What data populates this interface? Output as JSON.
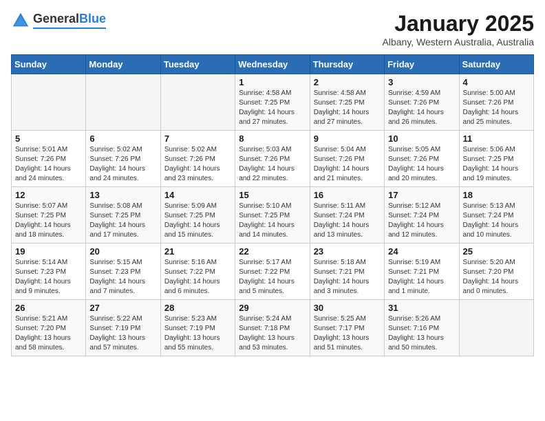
{
  "header": {
    "logo_general": "General",
    "logo_blue": "Blue",
    "month_title": "January 2025",
    "location": "Albany, Western Australia, Australia"
  },
  "weekdays": [
    "Sunday",
    "Monday",
    "Tuesday",
    "Wednesday",
    "Thursday",
    "Friday",
    "Saturday"
  ],
  "weeks": [
    [
      {
        "day": "",
        "info": ""
      },
      {
        "day": "",
        "info": ""
      },
      {
        "day": "",
        "info": ""
      },
      {
        "day": "1",
        "info": "Sunrise: 4:58 AM\nSunset: 7:25 PM\nDaylight: 14 hours\nand 27 minutes."
      },
      {
        "day": "2",
        "info": "Sunrise: 4:58 AM\nSunset: 7:25 PM\nDaylight: 14 hours\nand 27 minutes."
      },
      {
        "day": "3",
        "info": "Sunrise: 4:59 AM\nSunset: 7:26 PM\nDaylight: 14 hours\nand 26 minutes."
      },
      {
        "day": "4",
        "info": "Sunrise: 5:00 AM\nSunset: 7:26 PM\nDaylight: 14 hours\nand 25 minutes."
      }
    ],
    [
      {
        "day": "5",
        "info": "Sunrise: 5:01 AM\nSunset: 7:26 PM\nDaylight: 14 hours\nand 24 minutes."
      },
      {
        "day": "6",
        "info": "Sunrise: 5:02 AM\nSunset: 7:26 PM\nDaylight: 14 hours\nand 24 minutes."
      },
      {
        "day": "7",
        "info": "Sunrise: 5:02 AM\nSunset: 7:26 PM\nDaylight: 14 hours\nand 23 minutes."
      },
      {
        "day": "8",
        "info": "Sunrise: 5:03 AM\nSunset: 7:26 PM\nDaylight: 14 hours\nand 22 minutes."
      },
      {
        "day": "9",
        "info": "Sunrise: 5:04 AM\nSunset: 7:26 PM\nDaylight: 14 hours\nand 21 minutes."
      },
      {
        "day": "10",
        "info": "Sunrise: 5:05 AM\nSunset: 7:26 PM\nDaylight: 14 hours\nand 20 minutes."
      },
      {
        "day": "11",
        "info": "Sunrise: 5:06 AM\nSunset: 7:25 PM\nDaylight: 14 hours\nand 19 minutes."
      }
    ],
    [
      {
        "day": "12",
        "info": "Sunrise: 5:07 AM\nSunset: 7:25 PM\nDaylight: 14 hours\nand 18 minutes."
      },
      {
        "day": "13",
        "info": "Sunrise: 5:08 AM\nSunset: 7:25 PM\nDaylight: 14 hours\nand 17 minutes."
      },
      {
        "day": "14",
        "info": "Sunrise: 5:09 AM\nSunset: 7:25 PM\nDaylight: 14 hours\nand 15 minutes."
      },
      {
        "day": "15",
        "info": "Sunrise: 5:10 AM\nSunset: 7:25 PM\nDaylight: 14 hours\nand 14 minutes."
      },
      {
        "day": "16",
        "info": "Sunrise: 5:11 AM\nSunset: 7:24 PM\nDaylight: 14 hours\nand 13 minutes."
      },
      {
        "day": "17",
        "info": "Sunrise: 5:12 AM\nSunset: 7:24 PM\nDaylight: 14 hours\nand 12 minutes."
      },
      {
        "day": "18",
        "info": "Sunrise: 5:13 AM\nSunset: 7:24 PM\nDaylight: 14 hours\nand 10 minutes."
      }
    ],
    [
      {
        "day": "19",
        "info": "Sunrise: 5:14 AM\nSunset: 7:23 PM\nDaylight: 14 hours\nand 9 minutes."
      },
      {
        "day": "20",
        "info": "Sunrise: 5:15 AM\nSunset: 7:23 PM\nDaylight: 14 hours\nand 7 minutes."
      },
      {
        "day": "21",
        "info": "Sunrise: 5:16 AM\nSunset: 7:22 PM\nDaylight: 14 hours\nand 6 minutes."
      },
      {
        "day": "22",
        "info": "Sunrise: 5:17 AM\nSunset: 7:22 PM\nDaylight: 14 hours\nand 5 minutes."
      },
      {
        "day": "23",
        "info": "Sunrise: 5:18 AM\nSunset: 7:21 PM\nDaylight: 14 hours\nand 3 minutes."
      },
      {
        "day": "24",
        "info": "Sunrise: 5:19 AM\nSunset: 7:21 PM\nDaylight: 14 hours\nand 1 minute."
      },
      {
        "day": "25",
        "info": "Sunrise: 5:20 AM\nSunset: 7:20 PM\nDaylight: 14 hours\nand 0 minutes."
      }
    ],
    [
      {
        "day": "26",
        "info": "Sunrise: 5:21 AM\nSunset: 7:20 PM\nDaylight: 13 hours\nand 58 minutes."
      },
      {
        "day": "27",
        "info": "Sunrise: 5:22 AM\nSunset: 7:19 PM\nDaylight: 13 hours\nand 57 minutes."
      },
      {
        "day": "28",
        "info": "Sunrise: 5:23 AM\nSunset: 7:19 PM\nDaylight: 13 hours\nand 55 minutes."
      },
      {
        "day": "29",
        "info": "Sunrise: 5:24 AM\nSunset: 7:18 PM\nDaylight: 13 hours\nand 53 minutes."
      },
      {
        "day": "30",
        "info": "Sunrise: 5:25 AM\nSunset: 7:17 PM\nDaylight: 13 hours\nand 51 minutes."
      },
      {
        "day": "31",
        "info": "Sunrise: 5:26 AM\nSunset: 7:16 PM\nDaylight: 13 hours\nand 50 minutes."
      },
      {
        "day": "",
        "info": ""
      }
    ]
  ]
}
